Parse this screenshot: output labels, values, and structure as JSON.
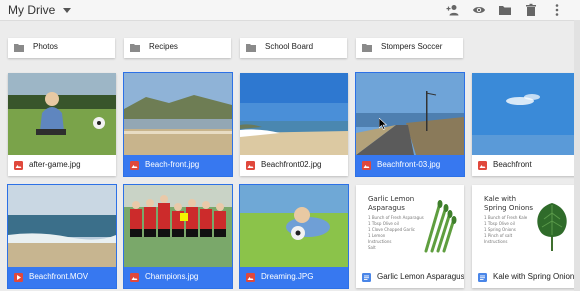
{
  "header": {
    "title": "My Drive"
  },
  "toolbar": {
    "share_icon": "add-person-icon",
    "preview_icon": "eye-icon",
    "move_icon": "folder-icon",
    "delete_icon": "trash-icon",
    "more_icon": "more-vert-icon"
  },
  "folders": [
    {
      "label": "Photos"
    },
    {
      "label": "Recipes"
    },
    {
      "label": "School Board"
    },
    {
      "label": "Stompers Soccer"
    }
  ],
  "files": [
    {
      "name": "after-game.jpg",
      "type": "image",
      "selected": false
    },
    {
      "name": "Beach-front.jpg",
      "type": "image",
      "selected": true
    },
    {
      "name": "Beachfront02.jpg",
      "type": "image",
      "selected": false
    },
    {
      "name": "Beachfront-03.jpg",
      "type": "image",
      "selected": true
    },
    {
      "name": "Beachfront",
      "type": "image",
      "selected": false
    },
    {
      "name": "Beachfront.MOV",
      "type": "video",
      "selected": true
    },
    {
      "name": "Champions.jpg",
      "type": "image",
      "selected": true
    },
    {
      "name": "Dreaming.JPG",
      "type": "image",
      "selected": true
    },
    {
      "name": "Garlic Lemon Asparagus",
      "type": "doc",
      "selected": false,
      "doc_title_lines": [
        "Garlic Lemon",
        "Asparagus"
      ],
      "doc_lines": [
        "1 Bunch of Fresh Asparagus",
        "1 Tbsp Olive oil",
        "1 Clove Chopped Garlic",
        "1 Lemon",
        "Instructions",
        "Salt"
      ]
    },
    {
      "name": "Kale with Spring Onions",
      "type": "doc",
      "selected": false,
      "doc_title_lines": [
        "Kale with",
        "Spring Onions"
      ],
      "doc_lines": [
        "1 Bunch of Fresh Kale",
        "1 Tbsp Olive oil",
        "1 Spring Onions",
        "1 Pinch of salt",
        "Instructions"
      ]
    }
  ],
  "colors": {
    "selection": "#3778f0",
    "image_icon": "#e0483c",
    "video_icon": "#e0483c",
    "doc_icon": "#4a86e8"
  }
}
